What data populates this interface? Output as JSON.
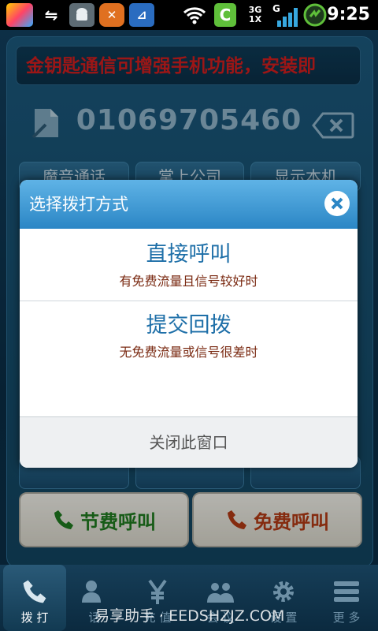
{
  "status_bar": {
    "time": "9:25",
    "network": "3G",
    "network_sub": "1X",
    "signal_letter": "G",
    "app_letter": "C"
  },
  "banner": {
    "text": "金钥匙通信可增强手机功能，安装即"
  },
  "dialer": {
    "number": "01069705460"
  },
  "feature_pills": [
    "魔音通话",
    "掌上公司",
    "显示本机"
  ],
  "call_buttons": {
    "save_call": "节费呼叫",
    "free_call": "免费呼叫"
  },
  "dialog": {
    "title": "选择拨打方式",
    "options": [
      {
        "title": "直接呼叫",
        "subtitle": "有免费流量且信号较好时"
      },
      {
        "title": "提交回拨",
        "subtitle": "无免费流量或信号很差时"
      }
    ],
    "close_window": "关闭此窗口"
  },
  "tabs": [
    {
      "label": "拨 打",
      "icon": "phone-icon",
      "active": true
    },
    {
      "label": "话",
      "icon": "contacts-icon",
      "active": false
    },
    {
      "label": "充 值",
      "icon": "yen-icon",
      "active": false
    },
    {
      "label": "会 议",
      "icon": "group-icon",
      "active": false
    },
    {
      "label": "设 置",
      "icon": "gear-icon",
      "active": false
    },
    {
      "label": "更 多",
      "icon": "menu-icon",
      "active": false
    }
  ],
  "watermark": "易享助手 · EEDSHZJZ.COM",
  "colors": {
    "accent": "#2b86c5",
    "banner_text": "#d11e1e",
    "save_call": "#1f7a1f",
    "free_call": "#b23a14"
  }
}
